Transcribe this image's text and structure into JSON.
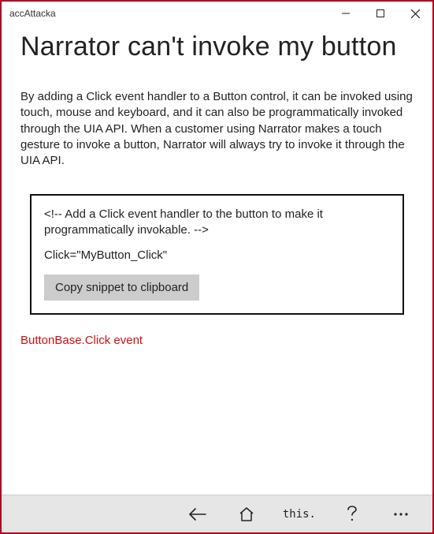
{
  "window": {
    "app_title": "accAttacka"
  },
  "page": {
    "title": "Narrator can't invoke my button",
    "body": "By adding a Click event handler to a Button control, it can be invoked using touch, mouse and keyboard, and it can also be programmatically invoked through the UIA API. When a customer using Narrator makes a touch gesture to invoke a button, Narrator will always try to invoke it through the UIA API."
  },
  "snippet": {
    "comment": "<!-- Add a Click event handler to the button to make it programmatically invokable. -->",
    "code": "Click=\"MyButton_Click\"",
    "copy_label": "Copy snippet to clipboard"
  },
  "link": {
    "text": "ButtonBase.Click event"
  },
  "bottombar": {
    "this_label": "this."
  }
}
